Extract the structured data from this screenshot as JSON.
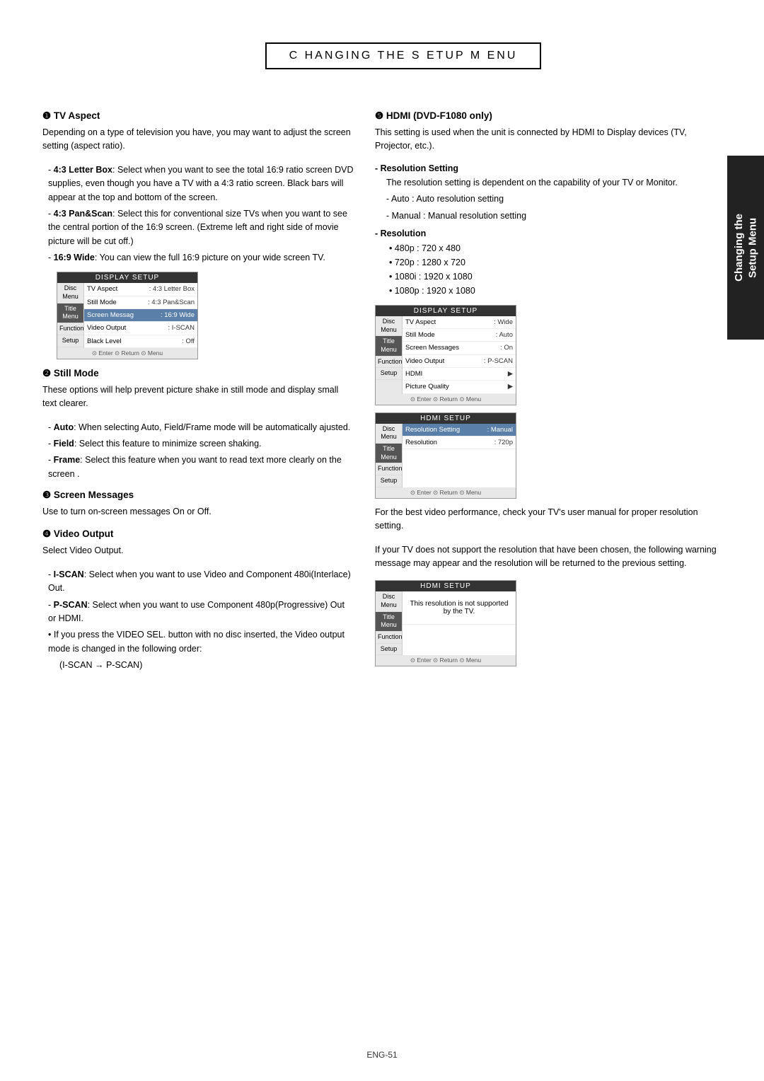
{
  "title": "Changing the Setup Menu",
  "title_display": "C HANGING THE  S ETUP  M ENU",
  "side_tab_line1": "Changing the",
  "side_tab_line2": "Setup Menu",
  "sections_left": [
    {
      "id": "tv-aspect",
      "number": "❶",
      "title": "TV Aspect",
      "body": "Depending on a type of television you have, you may want to adjust the screen setting (aspect ratio).",
      "bullets": [
        {
          "label": "4:3 Letter Box",
          "text": ": Select when you want to see the total 16:9 ratio screen DVD supplies, even though you have a TV with a 4:3 ratio screen. Black bars will appear at the top and bottom of the screen."
        },
        {
          "label": "4:3 Pan&Scan",
          "text": ": Select this for conventional size TVs when you want to see the central portion of the 16:9 screen. (Extreme left and right side of movie picture will be cut off.)"
        },
        {
          "label": "16:9 Wide",
          "text": ": You can view the full 16:9 picture on your wide screen TV."
        }
      ]
    },
    {
      "id": "still-mode",
      "number": "❷",
      "title": "Still Mode",
      "body": "These options will help prevent picture shake in still mode and display small text clearer.",
      "bullets": [
        {
          "label": "Auto",
          "text": ": When selecting Auto, Field/Frame mode will be automatically ajusted."
        },
        {
          "label": "Field",
          "text": ": Select this feature to minimize screen shaking."
        },
        {
          "label": "Frame",
          "text": ": Select this feature when you want to read text more clearly on the screen ."
        }
      ]
    },
    {
      "id": "screen-messages",
      "number": "❸",
      "title": "Screen Messages",
      "body": "Use to turn on-screen messages On or Off."
    },
    {
      "id": "video-output",
      "number": "❹",
      "title": "Video Output",
      "body": "Select Video Output.",
      "bullets": [
        {
          "label": "I-SCAN",
          "text": ": Select when you want to use Video and Component 480i(Interlace) Out."
        },
        {
          "label": "P-SCAN",
          "text": ": Select when you want to use Component 480p(Progressive) Out or HDMI."
        }
      ],
      "extra_bullets": [
        "If you press the VIDEO SEL. button with no disc inserted, the Video output mode is changed in the following order:",
        "(I-SCAN → P-SCAN)"
      ]
    }
  ],
  "sections_right": [
    {
      "id": "hdmi",
      "number": "❺",
      "title": "HDMI (DVD-F1080 only)",
      "body": "This setting is used when the unit is connected by HDMI to Display devices (TV, Projector, etc.).",
      "subsections": [
        {
          "title": "Resolution Setting",
          "body": "The resolution setting is dependent on the capability of your TV or Monitor.",
          "items": [
            "Auto : Auto resolution setting",
            "Manual : Manual resolution setting"
          ]
        },
        {
          "title": "Resolution",
          "items": [
            "480p : 720 x 480",
            "720p : 1280 x 720",
            "1080i : 1920 x 1080",
            "1080p : 1920 x 1080"
          ]
        }
      ],
      "after_tables": "For the best video performance, check your TV's user manual for proper resolution setting.",
      "warning_text": "If your TV does not support the resolution that have been chosen, the following warning message may appear and the resolution will be returned to the previous setting."
    }
  ],
  "display_table_1": {
    "header": "DISPLAY SETUP",
    "sidebar": [
      "Disc Menu",
      "Title Menu",
      "Function",
      "Setup"
    ],
    "rows": [
      {
        "key": "TV Aspect",
        "val": ": 4:3 Letter Box",
        "highlighted": false
      },
      {
        "key": "Still Mode",
        "val": ": 4:3 Pan&Scan",
        "highlighted": false
      },
      {
        "key": "Screen Messag",
        "val": ": 16:9 Wide",
        "highlighted": true
      },
      {
        "key": "Video Output",
        "val": ": I-SCAN",
        "highlighted": false
      },
      {
        "key": "Black Level",
        "val": ": Off",
        "highlighted": false
      }
    ],
    "footer": "⊙ Enter  ⊙ Return  ⊙ Menu"
  },
  "display_table_2": {
    "header": "DISPLAY SETUP",
    "sidebar": [
      "Disc Menu",
      "Title Menu",
      "Function",
      "Setup"
    ],
    "rows": [
      {
        "key": "TV Aspect",
        "val": ": Wide",
        "highlighted": false
      },
      {
        "key": "Still Mode",
        "val": ": Auto",
        "highlighted": false
      },
      {
        "key": "Screen Messages",
        "val": ": On",
        "highlighted": false
      },
      {
        "key": "Video Output",
        "val": ": P-SCAN",
        "highlighted": false
      },
      {
        "key": "HDMI",
        "val": "▶",
        "highlighted": false
      },
      {
        "key": "Picture Quality",
        "val": "▶",
        "highlighted": false
      }
    ],
    "footer": "⊙ Enter  ⊙ Return  ⊙ Menu"
  },
  "hdmi_table": {
    "header": "HDMI SETUP",
    "sidebar": [
      "Disc Menu",
      "Title Menu",
      "Function",
      "Setup"
    ],
    "rows": [
      {
        "key": "Resolution Setting",
        "val": ": Manual",
        "highlighted": true
      },
      {
        "key": "Resolution",
        "val": ": 720p",
        "highlighted": false
      }
    ],
    "footer": "⊙ Enter  ⊙ Return  ⊙ Menu"
  },
  "hdmi_warn_table": {
    "header": "HDMI SETUP",
    "sidebar": [
      "Disc Menu",
      "Title Menu",
      "Function",
      "Setup"
    ],
    "warn_text": "This resolution is not supported by the TV.",
    "footer": "⊙ Enter  ⊙ Return  ⊙ Menu"
  },
  "page_number": "ENG-51"
}
